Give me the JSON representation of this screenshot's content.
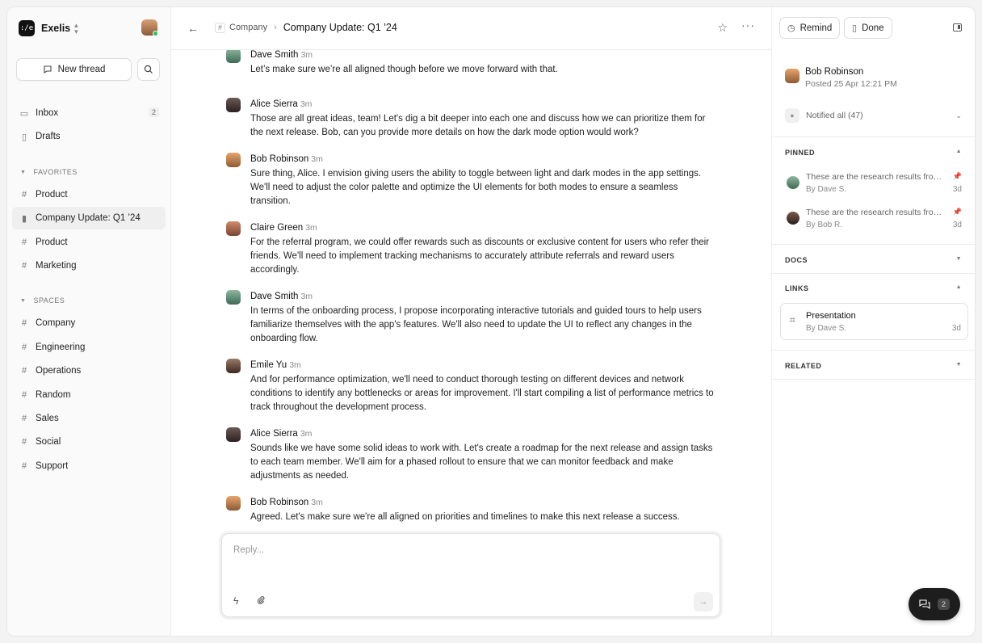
{
  "workspace": {
    "logo": ":/e",
    "name": "Exelis"
  },
  "sidebar": {
    "new_thread_label": "New thread",
    "top_items": [
      {
        "label": "Inbox",
        "badge": "2"
      },
      {
        "label": "Drafts"
      }
    ],
    "favorites_heading": "FAVORITES",
    "favorites": [
      {
        "label": "Product"
      },
      {
        "label": "Company Update: Q1 ’24"
      },
      {
        "label": "Product"
      },
      {
        "label": "Marketing"
      }
    ],
    "spaces_heading": "SPACES",
    "spaces": [
      {
        "label": "Company"
      },
      {
        "label": "Engineering"
      },
      {
        "label": "Operations"
      },
      {
        "label": "Random"
      },
      {
        "label": "Sales"
      },
      {
        "label": "Social"
      },
      {
        "label": "Support"
      }
    ]
  },
  "header": {
    "breadcrumb_space": "Company",
    "title": "Company Update: Q1 ’24"
  },
  "messages": [
    {
      "author": "Dave Smith",
      "time": "3m",
      "text": "Let’s make sure we’re all aligned though before we move forward with that."
    },
    {
      "author": "Alice Sierra",
      "time": "3m",
      "text": "Those are all great ideas, team! Let's dig a bit deeper into each one and discuss how we can prioritize them for the next release. Bob, can you provide more details on how the dark mode option would work?"
    },
    {
      "author": "Bob Robinson",
      "time": "3m",
      "text": "Sure thing, Alice. I envision giving users the ability to toggle between light and dark modes in the app settings. We'll need to adjust the color palette and optimize the UI elements for both modes to ensure a seamless transition."
    },
    {
      "author": "Claire Green",
      "time": "3m",
      "text": "For the referral program, we could offer rewards such as discounts or exclusive content for users who refer their friends. We'll need to implement tracking mechanisms to accurately attribute referrals and reward users accordingly."
    },
    {
      "author": "Dave Smith",
      "time": "3m",
      "text": "In terms of the onboarding process, I propose incorporating interactive tutorials and guided tours to help users familiarize themselves with the app's features. We'll also need to update the UI to reflect any changes in the onboarding flow."
    },
    {
      "author": "Emile Yu",
      "time": "3m",
      "text": "And for performance optimization, we'll need to conduct thorough testing on different devices and network conditions to identify any bottlenecks or areas for improvement. I'll start compiling a list of performance metrics to track throughout the development process."
    },
    {
      "author": "Alice Sierra",
      "time": "3m",
      "text": "Sounds like we have some solid ideas to work with. Let's create a roadmap for the next release and assign tasks to each team member. We'll aim for a phased rollout to ensure that we can monitor feedback and make adjustments as needed."
    },
    {
      "author": "Bob Robinson",
      "time": "3m",
      "text": "Agreed. Let's make sure we're all aligned on priorities and timelines to make this next release a success."
    }
  ],
  "reply": {
    "placeholder": "Reply..."
  },
  "right_panel": {
    "remind_label": "Remind",
    "done_label": "Done",
    "author_name": "Bob Robinson",
    "posted": "Posted 25 Apr 12:21 PM",
    "notified": "Notified all (47)",
    "pinned_heading": "PINNED",
    "pinned": [
      {
        "text": "These are the research results from the survey",
        "by": "By Dave S.",
        "age": "3d"
      },
      {
        "text": "These are the research results from the interviews",
        "by": "By Bob R.",
        "age": "3d"
      }
    ],
    "docs_heading": "DOCS",
    "links_heading": "LINKS",
    "link": {
      "title": "Presentation",
      "by": "By Dave S.",
      "age": "3d"
    },
    "related_heading": "RELATED"
  },
  "fab": {
    "count": "2"
  }
}
